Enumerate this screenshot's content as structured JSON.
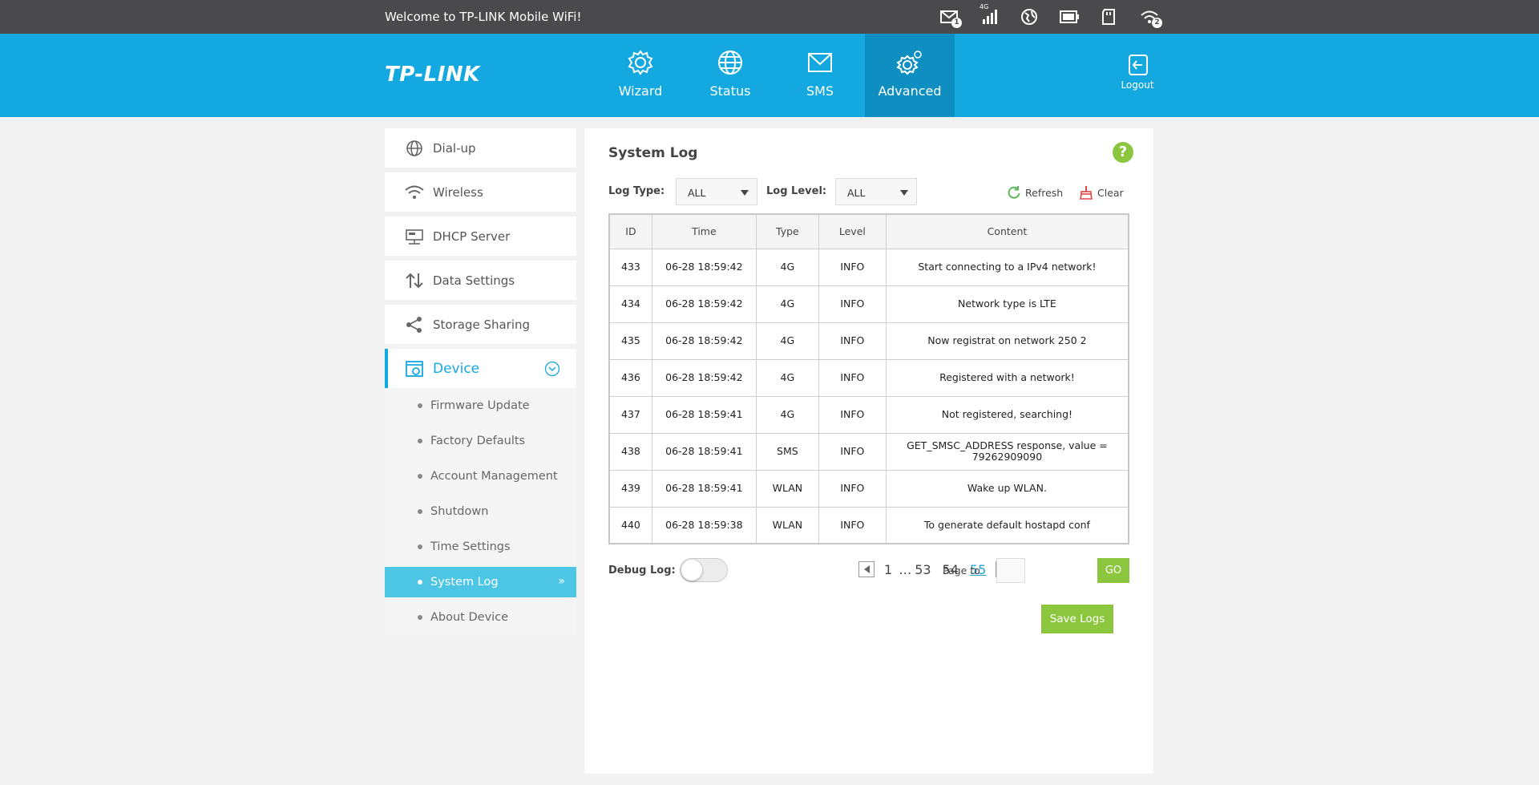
{
  "topbar": {
    "welcome": "Welcome to TP-LINK Mobile WiFi!",
    "icons": [
      {
        "name": "sms-icon",
        "badge": "1"
      },
      {
        "name": "signal-icon",
        "tag": "4G"
      },
      {
        "name": "internet-icon"
      },
      {
        "name": "battery-icon"
      },
      {
        "name": "sd-card-icon"
      },
      {
        "name": "wifi-clients-icon",
        "badge": "2"
      }
    ]
  },
  "header": {
    "logo": "TP-LINK",
    "nav": [
      {
        "label": "Wizard",
        "icon": "gear-icon"
      },
      {
        "label": "Status",
        "icon": "globe-icon"
      },
      {
        "label": "SMS",
        "icon": "envelope-icon"
      },
      {
        "label": "Advanced",
        "icon": "gears-icon",
        "active": true
      }
    ],
    "logout": "Logout"
  },
  "sidebar": {
    "items": [
      {
        "label": "Dial-up",
        "icon": "dialup-globe-icon"
      },
      {
        "label": "Wireless",
        "icon": "wifi-icon"
      },
      {
        "label": "DHCP Server",
        "icon": "dhcp-icon"
      },
      {
        "label": "Data Settings",
        "icon": "data-arrows-icon"
      },
      {
        "label": "Storage Sharing",
        "icon": "share-icon"
      },
      {
        "label": "Device",
        "icon": "device-icon",
        "active": true
      }
    ],
    "sub_items": [
      {
        "label": "Firmware Update"
      },
      {
        "label": "Factory Defaults"
      },
      {
        "label": "Account Management"
      },
      {
        "label": "Shutdown"
      },
      {
        "label": "Time Settings"
      },
      {
        "label": "System Log",
        "active": true
      },
      {
        "label": "About Device"
      }
    ]
  },
  "main": {
    "title": "System Log",
    "help": "?",
    "log_type_label": "Log Type:",
    "log_type_value": "ALL",
    "log_level_label": "Log Level:",
    "log_level_value": "ALL",
    "refresh": "Refresh",
    "clear": "Clear",
    "table": {
      "headers": [
        "ID",
        "Time",
        "Type",
        "Level",
        "Content"
      ],
      "rows": [
        [
          "433",
          "06-28 18:59:42",
          "4G",
          "INFO",
          "Start connecting to a IPv4 network!"
        ],
        [
          "434",
          "06-28 18:59:42",
          "4G",
          "INFO",
          "Network type is LTE"
        ],
        [
          "435",
          "06-28 18:59:42",
          "4G",
          "INFO",
          "Now registrat on network 250 2"
        ],
        [
          "436",
          "06-28 18:59:42",
          "4G",
          "INFO",
          "Registered with a network!"
        ],
        [
          "437",
          "06-28 18:59:41",
          "4G",
          "INFO",
          "Not registered, searching!"
        ],
        [
          "438",
          "06-28 18:59:41",
          "SMS",
          "INFO",
          "GET_SMSC_ADDRESS response, value = 79262909090"
        ],
        [
          "439",
          "06-28 18:59:41",
          "WLAN",
          "INFO",
          "Wake up WLAN."
        ],
        [
          "440",
          "06-28 18:59:38",
          "WLAN",
          "INFO",
          "To generate default hostapd conf"
        ]
      ]
    },
    "debug_log_label": "Debug Log:",
    "debug_log_on": false,
    "pager": {
      "pages": [
        "1",
        "…",
        "53",
        "54",
        "55"
      ],
      "current": "55",
      "page_to_label": "Page to",
      "page_input": "",
      "go": "GO"
    },
    "save_logs": "Save Logs",
    "colors": {
      "brand": "#14a8e1",
      "accent_green": "#8cc63f",
      "topbar": "#4a4a4d"
    }
  }
}
